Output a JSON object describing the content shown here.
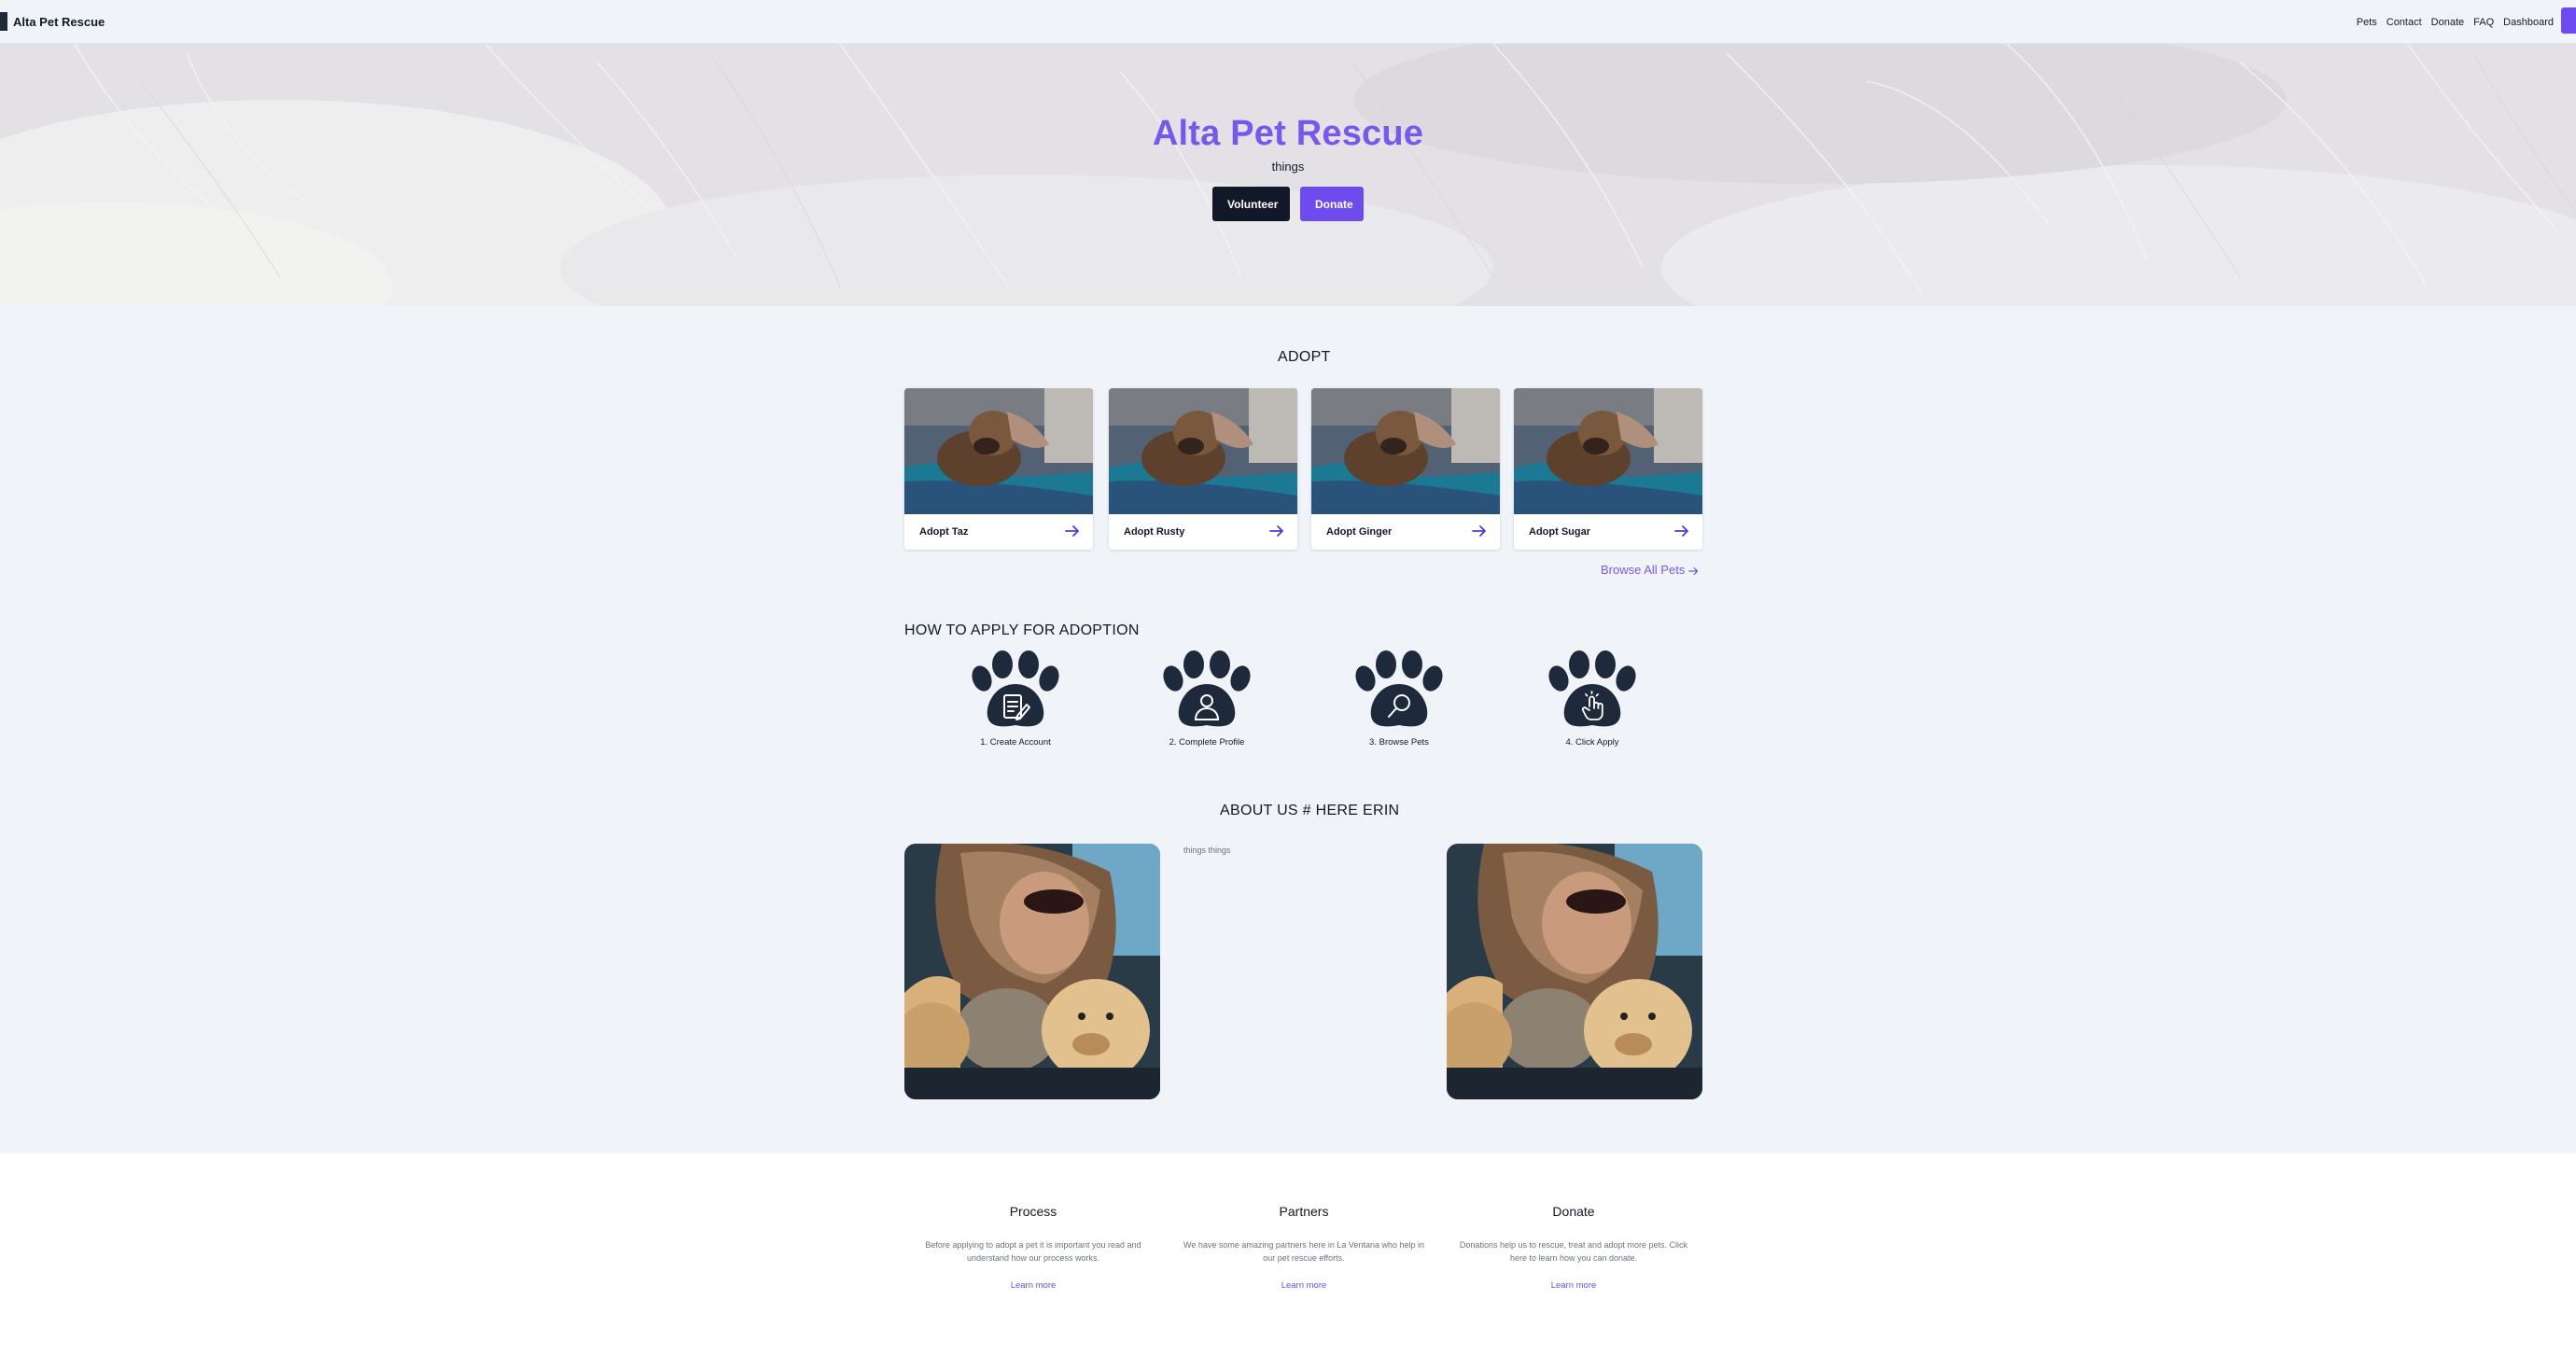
{
  "nav": {
    "brand": "Alta Pet Rescue",
    "links": [
      "Pets",
      "Contact",
      "Donate",
      "FAQ",
      "Dashboard"
    ]
  },
  "hero": {
    "title": "Alta Pet Rescue",
    "subtitle": "things",
    "volunteer_label": "Volunteer",
    "donate_label": "Donate"
  },
  "adopt": {
    "title": "ADOPT",
    "pets": [
      {
        "label": "Adopt Taz"
      },
      {
        "label": "Adopt Rusty"
      },
      {
        "label": "Adopt Ginger"
      },
      {
        "label": "Adopt Sugar"
      }
    ],
    "browse_all": "Browse All Pets"
  },
  "how_to": {
    "title": "HOW TO APPLY FOR ADOPTION",
    "steps": [
      {
        "label": "1. Create Account",
        "icon": "document-edit-icon"
      },
      {
        "label": "2. Complete Profile",
        "icon": "user-icon"
      },
      {
        "label": "3. Browse Pets",
        "icon": "search-icon"
      },
      {
        "label": "4. Click Apply",
        "icon": "tap-icon"
      }
    ]
  },
  "about": {
    "title": "ABOUT US # HERE ERIN",
    "text": "things things"
  },
  "footer": {
    "columns": [
      {
        "title": "Process",
        "text": "Before applying to adopt a pet it is important you read and understand how our process works.",
        "link": "Learn more"
      },
      {
        "title": "Partners",
        "text": "We have some amazing partners here in La Ventana who help in our pet rescue efforts.",
        "link": "Learn more"
      },
      {
        "title": "Donate",
        "text": "Donations help us to rescue, treat and adopt more pets. Click here to learn how you can donate.",
        "link": "Learn more"
      }
    ]
  },
  "colors": {
    "accent": "#6d4bee",
    "title_purple": "#7658ea",
    "dark": "#111827",
    "paw": "#1e293b"
  }
}
